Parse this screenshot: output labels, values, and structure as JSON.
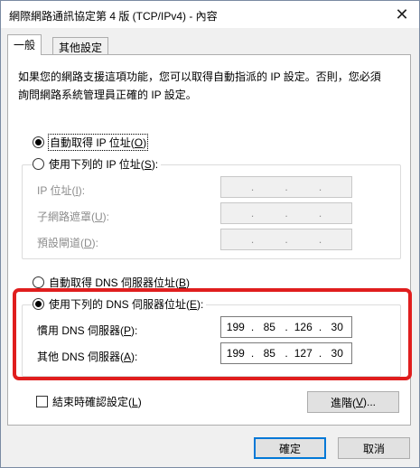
{
  "window": {
    "title": "網際網路通訊協定第 4 版 (TCP/IPv4) - 內容",
    "close_glyph": "✕"
  },
  "tabs": [
    {
      "label": "一般",
      "active": true
    },
    {
      "label": "其他設定",
      "active": false
    }
  ],
  "description": {
    "line1": "如果您的網路支援這項功能，您可以取得自動指派的 IP 設定。否則，您必須",
    "line2": "詢問網路系統管理員正確的 IP 設定。"
  },
  "ip_section": {
    "auto_option": {
      "label": "自動取得 IP 位址(",
      "hotkey": "O",
      "tail": ")",
      "checked": true
    },
    "manual_option": {
      "label": "使用下列的 IP 位址(",
      "hotkey": "S",
      "tail": "):",
      "checked": false
    },
    "fields": [
      {
        "label": "IP 位址(",
        "hotkey": "I",
        "tail": "):",
        "octets": [
          "",
          "",
          "",
          ""
        ],
        "dot": "."
      },
      {
        "label": "子網路遮罩(",
        "hotkey": "U",
        "tail": "):",
        "octets": [
          "",
          "",
          "",
          ""
        ],
        "dot": "."
      },
      {
        "label": "預設閘道(",
        "hotkey": "D",
        "tail": "):",
        "octets": [
          "",
          "",
          "",
          ""
        ],
        "dot": "."
      }
    ]
  },
  "dns_section": {
    "auto_option": {
      "label": "自動取得 DNS 伺服器位址(",
      "hotkey": "B",
      "tail": ")",
      "checked": false
    },
    "manual_option": {
      "label": "使用下列的 DNS 伺服器位址(",
      "hotkey": "E",
      "tail": "):",
      "checked": true
    },
    "fields": [
      {
        "label": "慣用 DNS 伺服器(",
        "hotkey": "P",
        "tail": "):",
        "octets": [
          "199",
          "85",
          "126",
          "30"
        ],
        "dot": "."
      },
      {
        "label": "其他 DNS 伺服器(",
        "hotkey": "A",
        "tail": "):",
        "octets": [
          "199",
          "85",
          "127",
          "30"
        ],
        "dot": "."
      }
    ]
  },
  "validate_checkbox": {
    "label": "結束時確認設定(",
    "hotkey": "L",
    "tail": ")",
    "checked": false
  },
  "buttons": {
    "advanced": {
      "label": "進階(",
      "hotkey": "V",
      "tail": ")..."
    },
    "ok": "確定",
    "cancel": "取消"
  },
  "colors": {
    "highlight_frame": "#e01e1e",
    "default_button_border": "#0078d7"
  }
}
